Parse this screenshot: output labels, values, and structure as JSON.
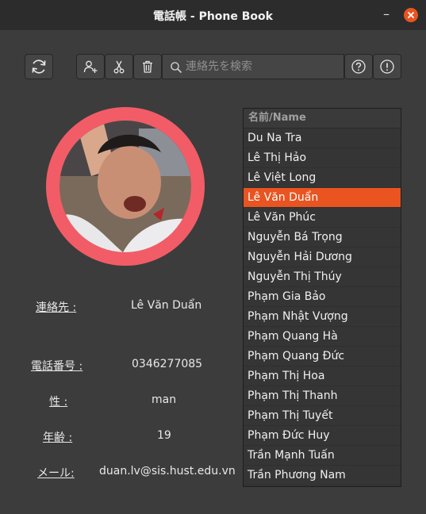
{
  "window": {
    "title": "電話帳 - Phone Book"
  },
  "toolbar": {
    "search_placeholder": "連絡先を検索"
  },
  "details": {
    "contact_label": "連絡先 :",
    "contact_value": "Lê Văn Duẩn",
    "phone_label": "電話番号 :",
    "phone_value": "0346277085",
    "gender_label": "性 :",
    "gender_value": "man",
    "age_label": "年齢 :",
    "age_value": "19",
    "email_label": "メール:",
    "email_value": "duan.lv@sis.hust.edu.vn"
  },
  "list": {
    "header": "名前/Name",
    "items": [
      "Du Na Tra",
      "Lê Thị  Hảo",
      "Lê Việt Long",
      "Lê Văn Duẩn",
      "Lê Văn Phúc",
      "Nguyễn Bá Trọng",
      "Nguyễn Hải Dương",
      "Nguyễn Thị Thúy",
      "Phạm Gia Bảo",
      "Phạm Nhật Vượng",
      "Phạm Quang Hà",
      "Phạm Quang Đức",
      "Phạm Thị Hoa",
      "Phạm Thị  Thanh",
      "Phạm Thị  Tuyết",
      "Phạm Đức Huy",
      "Trần Mạnh Tuấn",
      "Trần Phương Nam"
    ],
    "selected_index": 3
  },
  "colors": {
    "accent": "#e95420",
    "avatar_ring": "#f25c67"
  }
}
